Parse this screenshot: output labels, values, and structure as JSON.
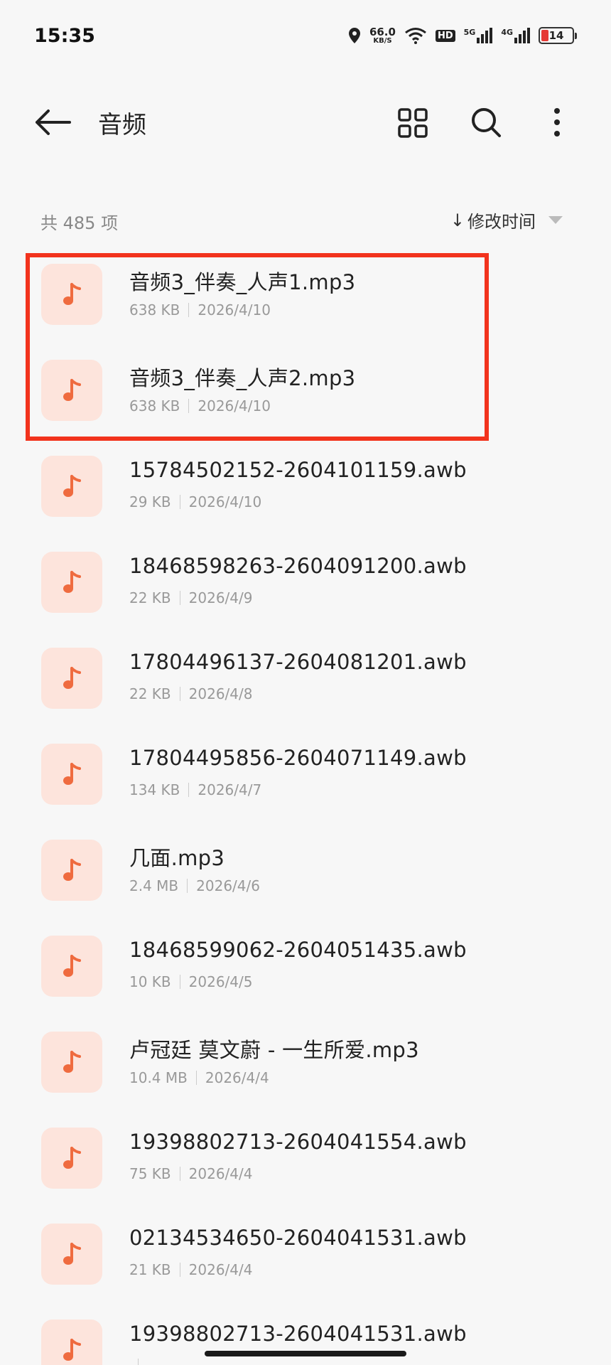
{
  "status": {
    "time": "15:35",
    "speed": "66.0",
    "speed_unit": "KB/S",
    "hd": "HD",
    "net1": "5G",
    "net2": "4G",
    "battery": "14"
  },
  "header": {
    "title": "音频"
  },
  "list": {
    "count": "共 485 项",
    "sort_label": "修改时间",
    "sort_arrow": "↓"
  },
  "files": [
    {
      "name": "音频3_伴奏_人声1.mp3",
      "size": "638 KB",
      "date": "2026/4/10"
    },
    {
      "name": "音频3_伴奏_人声2.mp3",
      "size": "638 KB",
      "date": "2026/4/10"
    },
    {
      "name": "15784502152-2604101159.awb",
      "size": "29 KB",
      "date": "2026/4/10"
    },
    {
      "name": "18468598263-2604091200.awb",
      "size": "22 KB",
      "date": "2026/4/9"
    },
    {
      "name": "17804496137-2604081201.awb",
      "size": "22 KB",
      "date": "2026/4/8"
    },
    {
      "name": "17804495856-2604071149.awb",
      "size": "134 KB",
      "date": "2026/4/7"
    },
    {
      "name": "几面.mp3",
      "size": "2.4 MB",
      "date": "2026/4/6"
    },
    {
      "name": "18468599062-2604051435.awb",
      "size": "10 KB",
      "date": "2026/4/5"
    },
    {
      "name": "卢冠廷 莫文蔚 - 一生所爱.mp3",
      "size": "10.4 MB",
      "date": "2026/4/4"
    },
    {
      "name": "19398802713-2604041554.awb",
      "size": "75 KB",
      "date": "2026/4/4"
    },
    {
      "name": "02134534650-2604041531.awb",
      "size": "21 KB",
      "date": "2026/4/4"
    },
    {
      "name": "19398802713-2604041531.awb",
      "size": "",
      "date": ""
    }
  ],
  "colors": {
    "accent": "#ef6b3f",
    "icon_bg": "#fde4dc",
    "highlight": "#f2331d"
  }
}
